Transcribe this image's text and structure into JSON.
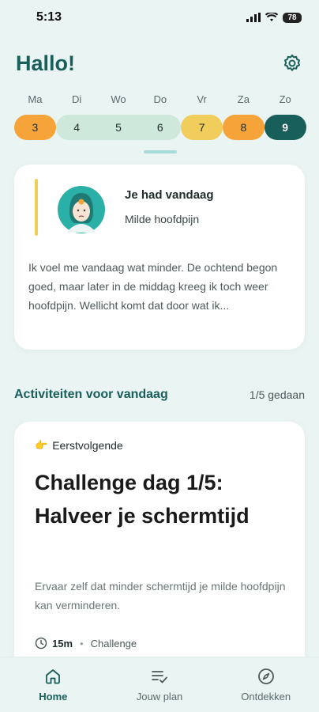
{
  "status": {
    "time": "5:13",
    "battery": "78"
  },
  "header": {
    "greeting": "Hallo!"
  },
  "week": {
    "days": [
      {
        "label": "Ma",
        "date": "3"
      },
      {
        "label": "Di",
        "date": "4"
      },
      {
        "label": "Wo",
        "date": "5"
      },
      {
        "label": "Do",
        "date": "6"
      },
      {
        "label": "Vr",
        "date": "7"
      },
      {
        "label": "Za",
        "date": "8"
      },
      {
        "label": "Zo",
        "date": "9"
      }
    ]
  },
  "symptom": {
    "title": "Je had vandaag",
    "value": "Milde hoofdpijn",
    "note": "Ik voel me vandaag wat minder. De ochtend begon goed, maar later in de middag kreeg ik toch weer hoofdpijn. Wellicht komt dat door wat ik..."
  },
  "activities": {
    "title": "Activiteiten voor vandaag",
    "count": "1/5 gedaan",
    "next_label": "Eerstvolgende",
    "card_title": "Challenge dag 1/5: Halveer je schermtijd",
    "description": "Ervaar zelf dat minder schermtijd je milde hoofdpijn kan verminderen.",
    "duration": "15m",
    "type": "Challenge"
  },
  "tabs": [
    {
      "label": "Home",
      "icon": "home-icon"
    },
    {
      "label": "Jouw plan",
      "icon": "checklist-icon"
    },
    {
      "label": "Ontdekken",
      "icon": "compass-icon"
    }
  ],
  "colors": {
    "primary": "#185e5a",
    "orange": "#f6a43a",
    "green": "#cfe8dc",
    "yellow": "#f1cd5c",
    "background": "#eaf4f3"
  }
}
